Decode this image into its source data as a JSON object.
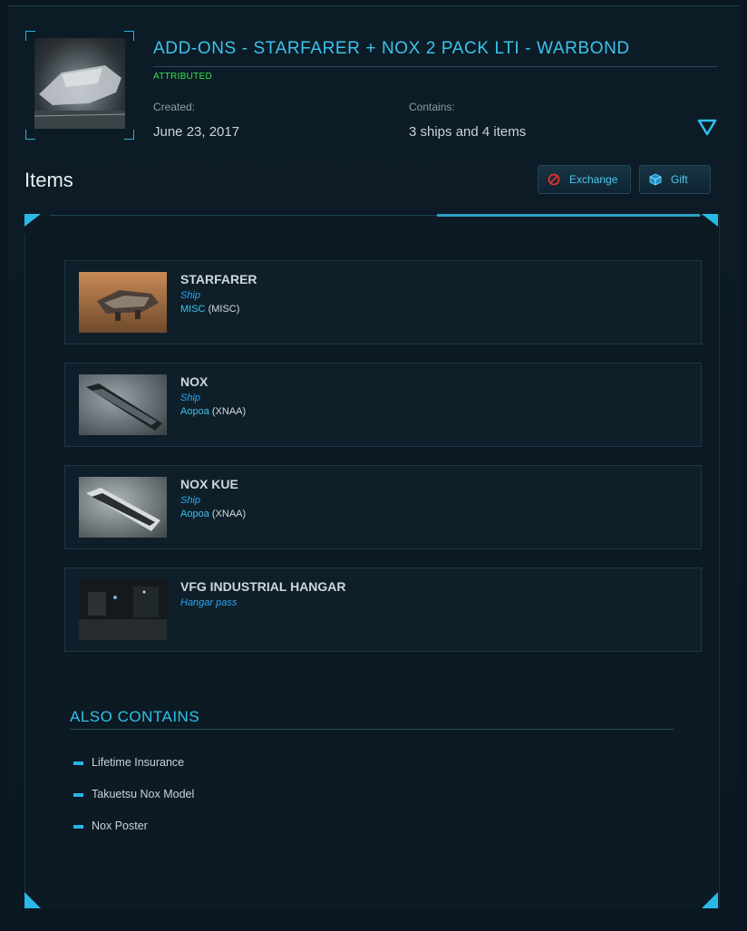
{
  "header": {
    "title": "ADD-ONS - STARFARER + NOX 2 PACK LTI - WARBOND",
    "status": "ATTRIBUTED",
    "created_label": "Created:",
    "created_value": "June 23, 2017",
    "contains_label": "Contains:",
    "contains_value": "3 ships and 4 items",
    "thumbnail_icon": "ship-image",
    "toggle_icon": "triangle-down-icon"
  },
  "items_section": {
    "title": "Items",
    "exchange_label": "Exchange",
    "gift_label": "Gift",
    "exchange_icon": "prohibited-icon",
    "gift_icon": "cube-icon"
  },
  "items": [
    {
      "name": "STARFARER",
      "kind": "Ship",
      "manufacturer": "MISC",
      "code": "(MISC)"
    },
    {
      "name": "NOX",
      "kind": "Ship",
      "manufacturer": "Aopoa",
      "code": "(XNAA)"
    },
    {
      "name": "NOX KUE",
      "kind": "Ship",
      "manufacturer": "Aopoa",
      "code": "(XNAA)"
    },
    {
      "name": "VFG INDUSTRIAL HANGAR",
      "kind": "Hangar pass"
    }
  ],
  "also_contains": {
    "title": "ALSO CONTAINS",
    "items": [
      "Lifetime Insurance",
      "Takuetsu Nox Model",
      "Nox Poster"
    ]
  },
  "colors": {
    "accent": "#3cc3ec",
    "status_green": "#39e24e",
    "background": "#0a1720",
    "exchange_icon_red": "#e0302a"
  }
}
